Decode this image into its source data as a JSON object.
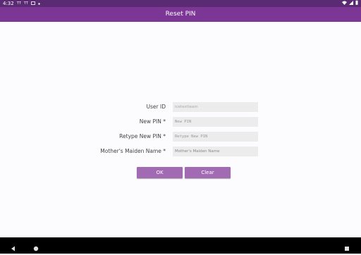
{
  "status_bar": {
    "time": "4:32",
    "notification_icons": [
      "tt-icon",
      "tt-icon",
      "image-icon",
      "dot-icon"
    ],
    "system_icons": [
      "wifi-icon",
      "signal-icon",
      "battery-icon"
    ]
  },
  "title_bar": {
    "title": "Reset PIN"
  },
  "form": {
    "user_id": {
      "label": "User ID",
      "value": "icetestteam"
    },
    "new_pin": {
      "label": "New PIN *",
      "placeholder": "New PIN"
    },
    "retype_pin": {
      "label": "Retype New PIN *",
      "placeholder": "Retype New PIN"
    },
    "maiden_name": {
      "label": "Mother's Maiden Name *",
      "placeholder": "Mother's Maiden Name"
    }
  },
  "buttons": {
    "ok": "OK",
    "clear": "Clear"
  },
  "colors": {
    "title_bar": "#7b3696",
    "status_bar": "#5a2a72",
    "button": "#a36ab4"
  },
  "nav_bar": {
    "icons": [
      "back-icon",
      "home-icon",
      "recents-icon"
    ]
  }
}
